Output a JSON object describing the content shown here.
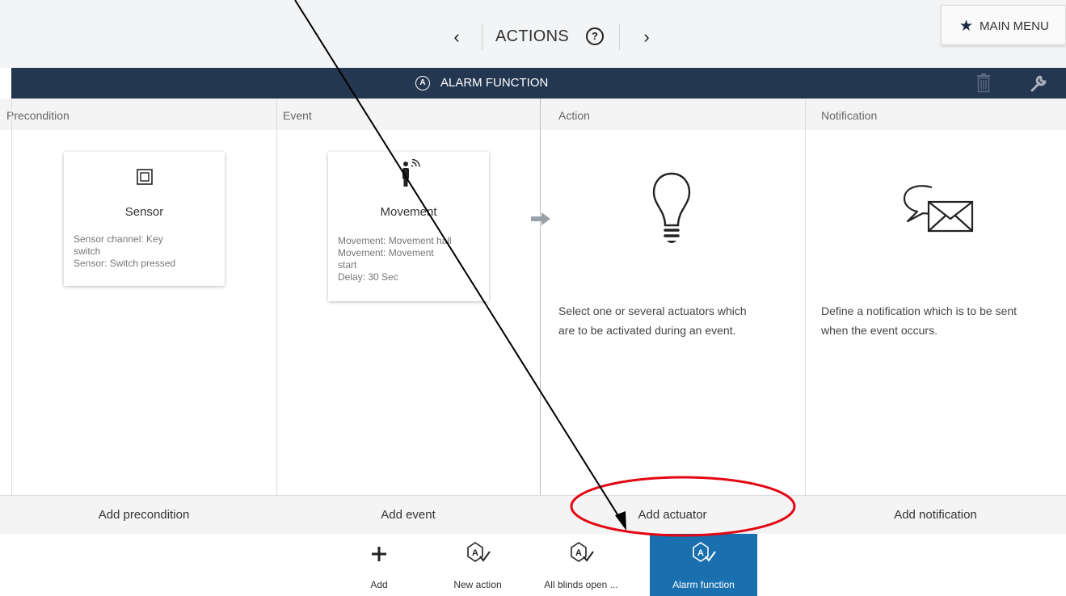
{
  "topbar": {
    "title": "ACTIONS",
    "prev_symbol": "‹",
    "next_symbol": "›",
    "help_symbol": "?",
    "main_menu_label": "MAIN MENU",
    "main_menu_icon": "star-icon"
  },
  "header": {
    "icon_letter": "A",
    "title": "ALARM FUNCTION",
    "icons": [
      "trash-icon",
      "wrench-icon"
    ]
  },
  "columns": [
    {
      "label": "Precondition"
    },
    {
      "label": "Event"
    },
    {
      "label": "Action"
    },
    {
      "label": "Notification"
    }
  ],
  "precondition_card": {
    "icon": "sensor-icon",
    "title": "Sensor",
    "lines": [
      "Sensor channel: Key",
      "switch",
      "Sensor: Switch pressed"
    ]
  },
  "event_card": {
    "icon": "movement-icon",
    "title": "Movement",
    "lines": [
      "Movement: Movement hall",
      "Movement: Movement",
      "start",
      "Delay: 30 Sec"
    ]
  },
  "action_placeholder": {
    "icon": "lightbulb-icon",
    "lines": [
      "Select one or several actuators which",
      "are to be activated during an event."
    ]
  },
  "notification_placeholder": {
    "icon": "message-envelope-icon",
    "lines": [
      "Define a notification which is to be sent",
      "when the event occurs."
    ]
  },
  "add_buttons": [
    "Add precondition",
    "Add event",
    "Add actuator",
    "Add notification"
  ],
  "toolbar": [
    {
      "label": "Add",
      "icon": "plus-icon",
      "active": false
    },
    {
      "label": "New action",
      "icon": "action-icon",
      "active": false
    },
    {
      "label": "All blinds open ...",
      "icon": "action-icon",
      "active": false
    },
    {
      "label": "Alarm function",
      "icon": "action-icon",
      "active": true
    }
  ],
  "colors": {
    "header": "#243750",
    "active_tab": "#1a6fae",
    "annotation_circle": "#e30613",
    "annotation_arrow": "#000000"
  }
}
